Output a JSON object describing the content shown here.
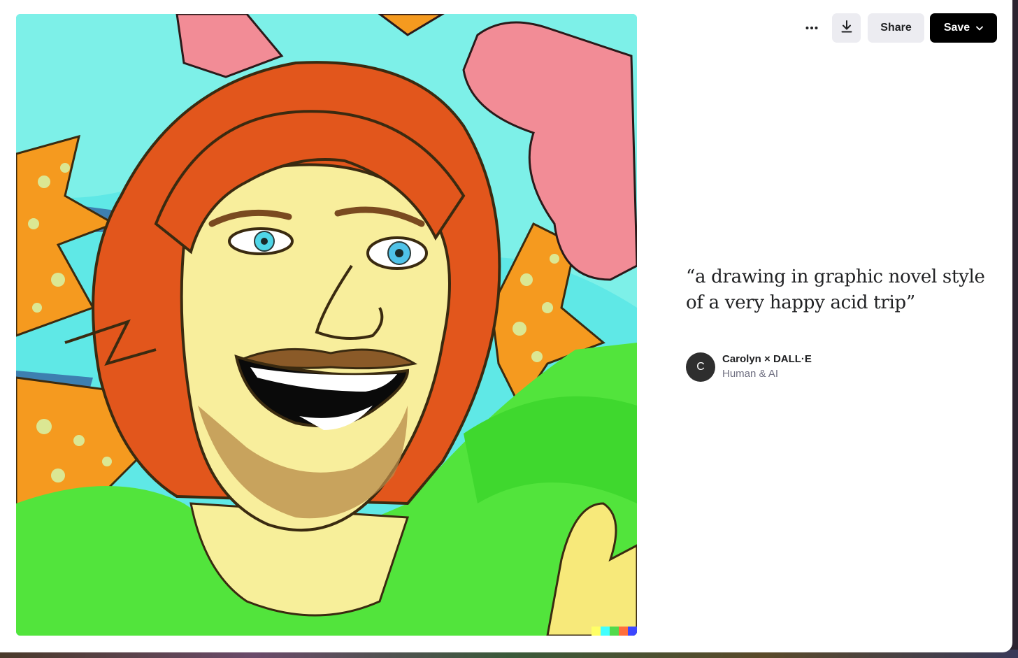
{
  "toolbar": {
    "more_icon": "ellipsis-icon",
    "download_icon": "download-icon",
    "share_label": "Share",
    "save_label": "Save",
    "save_icon": "chevron-down-icon"
  },
  "artwork": {
    "color_tag": [
      "#ffff66",
      "#42ffff",
      "#51da4c",
      "#ff6e3c",
      "#3c46ff"
    ]
  },
  "prompt": {
    "text": "“a drawing in graphic novel style of a very happy acid trip”"
  },
  "author": {
    "initial": "C",
    "name": "Carolyn × DALL·E",
    "subtitle": "Human & AI"
  }
}
